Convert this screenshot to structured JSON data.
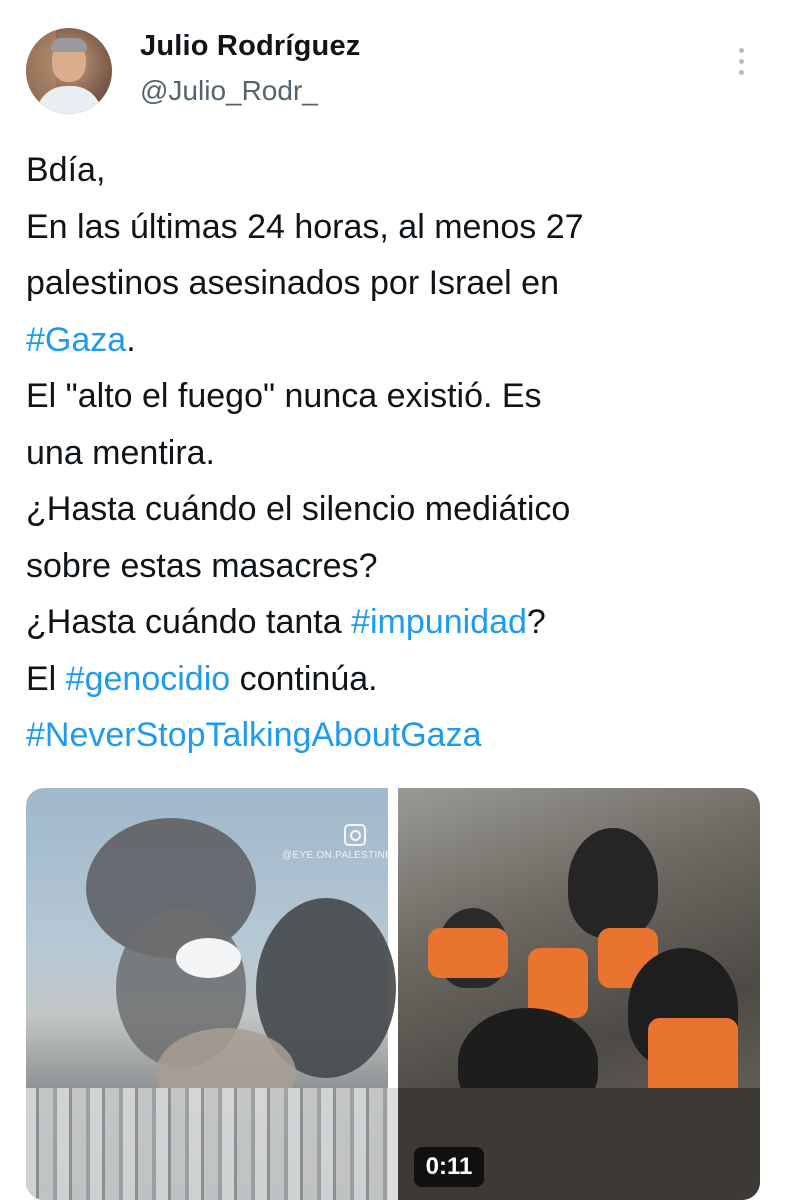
{
  "author": {
    "name": "Julio Rodríguez",
    "handle": "@Julio_Rodr_"
  },
  "tweet": {
    "line1": "Bdía,",
    "line2": "En las últimas 24 horas, al menos 27",
    "line3": "palestinos asesinados por Israel en",
    "hashtag_gaza": "#Gaza",
    "period1": ".",
    "line5": "El \"alto el fuego\" nunca existió. Es",
    "line6": "una mentira.",
    "line7": "¿Hasta cuándo el silencio mediático",
    "line8": "sobre estas masacres?",
    "line9_pre": "¿Hasta cuándo tanta ",
    "hashtag_impunidad": "#impunidad",
    "line9_post": "?",
    "line10_pre": "El ",
    "hashtag_genocidio": "#genocidio",
    "line10_post": " continúa.",
    "hashtag_never": "#NeverStopTalkingAboutGaza"
  },
  "media": {
    "image1_watermark": "@EYE.ON.PALESTINE",
    "video_duration": "0:11"
  },
  "colors": {
    "hashtag": "#1d9bf0",
    "text": "#0f1419",
    "secondary": "#536471"
  },
  "icons": {
    "more": "more-vertical-icon",
    "instagram": "instagram-icon"
  }
}
